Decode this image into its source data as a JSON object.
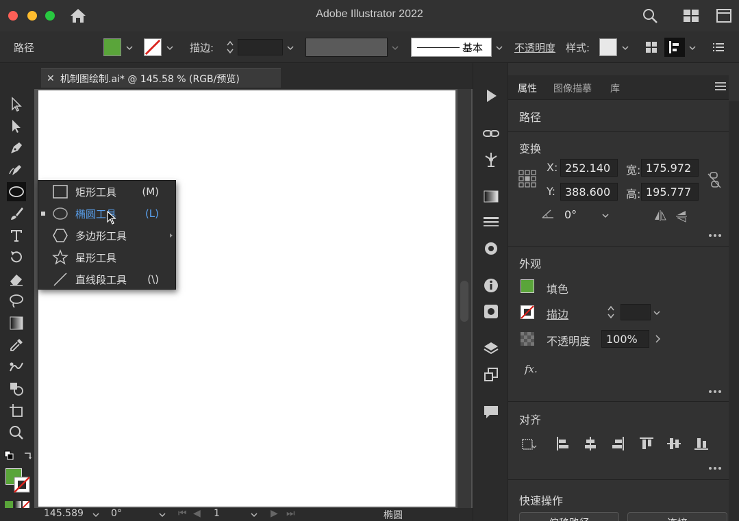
{
  "window": {
    "title": "Adobe Illustrator 2022"
  },
  "control_bar": {
    "object_type": "路径",
    "stroke_label": "描边:",
    "stroke_style": "基本",
    "opacity_label": "不透明度",
    "style_label": "样式:",
    "fill_color": "#5aa53a"
  },
  "document_tab": {
    "close": "✕",
    "title": "机制图绘制.ai* @ 145.58 % (RGB/预览)"
  },
  "tool_flyout": {
    "items": [
      {
        "label": "矩形工具",
        "shortcut": "(M)",
        "icon": "rectangle-icon"
      },
      {
        "label": "椭圆工具",
        "shortcut": "(L)",
        "icon": "ellipse-icon",
        "active": true
      },
      {
        "label": "多边形工具",
        "shortcut": "",
        "icon": "polygon-icon"
      },
      {
        "label": "星形工具",
        "shortcut": "",
        "icon": "star-icon"
      },
      {
        "label": "直线段工具",
        "shortcut": "(\\)",
        "icon": "line-segment-icon"
      }
    ]
  },
  "status_bar": {
    "zoom": "145.589",
    "rotation": "0°",
    "artboard": "1",
    "current_tool": "椭圆"
  },
  "properties_panel": {
    "tabs": [
      "属性",
      "图像描摹",
      "库"
    ],
    "selection": "路径",
    "transform": {
      "title": "变换",
      "x_label": "X:",
      "x_value": "252.140",
      "y_label": "Y:",
      "y_value": "388.600",
      "w_label": "宽:",
      "w_value": "175.972",
      "h_label": "高:",
      "h_value": "195.777",
      "angle": "0°"
    },
    "appearance": {
      "title": "外观",
      "fill_label": "填色",
      "stroke_label": "描边",
      "opacity_label": "不透明度",
      "opacity_value": "100%",
      "fx_label": "fx."
    },
    "align": {
      "title": "对齐"
    },
    "quick_actions": {
      "title": "快速操作",
      "button1": "偏移路径",
      "button2": "连接"
    }
  },
  "colors": {
    "fill_green": "#5aa53a",
    "accent_blue": "#5aa2f0",
    "stroke_none_red": "#d9221c"
  }
}
